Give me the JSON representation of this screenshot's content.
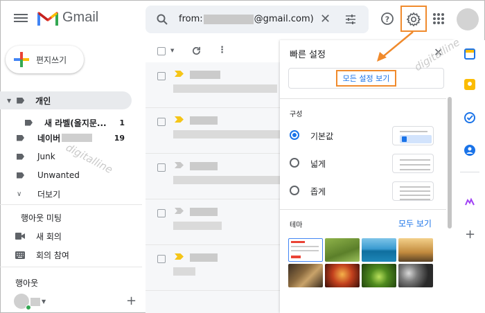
{
  "header": {
    "app_name": "Gmail",
    "search_prefix": "from:",
    "search_suffix": "@gmail.com)"
  },
  "sidebar": {
    "compose_label": "편지쓰기",
    "labels": [
      {
        "name": "개인",
        "count": ""
      },
      {
        "name": "새 라벨(올지문...",
        "count": "1"
      },
      {
        "name": "네이버",
        "count": "19"
      },
      {
        "name": "Junk",
        "count": ""
      },
      {
        "name": "Unwanted",
        "count": ""
      },
      {
        "name": "더보기",
        "count": ""
      }
    ],
    "meet_section": "행아웃 미팅",
    "meet_new": "새 회의",
    "meet_join": "회의 참여",
    "hangouts_section": "행아웃"
  },
  "quick_settings": {
    "title": "빠른 설정",
    "all_settings_label": "모든 설정 보기",
    "density_heading": "구성",
    "density_options": [
      "기본값",
      "넓게",
      "좁게"
    ],
    "selected_density": "기본값",
    "theme_heading": "테마",
    "theme_view_all": "모두 보기"
  },
  "watermark": "digitalline",
  "colors": {
    "accent": "#1a73e8",
    "highlight": "#f08a2c",
    "important_marker": "#f5c518"
  }
}
